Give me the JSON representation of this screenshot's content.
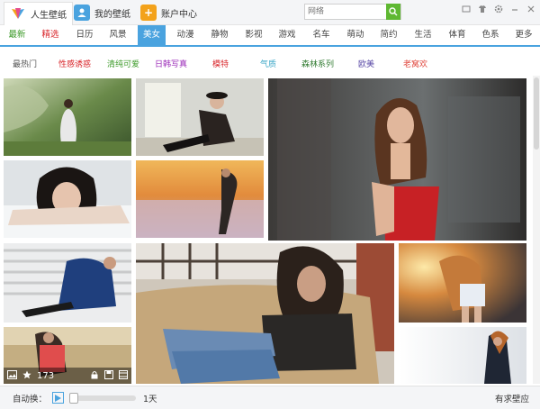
{
  "titlebar": {
    "tabs": [
      {
        "label": "人生壁纸",
        "icon": "app-logo-icon"
      },
      {
        "label": "我的壁纸",
        "icon": "user-icon"
      },
      {
        "label": "账户中心",
        "icon": "plus-icon"
      }
    ],
    "search_placeholder": "网络",
    "window_controls": [
      "skin-icon",
      "shirt-icon",
      "settings-icon",
      "minimize-icon",
      "close-icon"
    ]
  },
  "categories": [
    "最新",
    "精选",
    "日历",
    "风景",
    "美女",
    "动漫",
    "静物",
    "影视",
    "游戏",
    "名车",
    "萌动",
    "简约",
    "生活",
    "体育",
    "色系",
    "更多"
  ],
  "active_category": "美女",
  "subcategories": [
    {
      "label": "最热门",
      "color": "#555555"
    },
    {
      "label": "性感诱惑",
      "color": "#d9262b"
    },
    {
      "label": "清纯可爱",
      "color": "#3e9b2b"
    },
    {
      "label": "日韩写真",
      "color": "#9b2bb8"
    },
    {
      "label": "模特",
      "color": "#d9262b"
    },
    {
      "label": "气质",
      "color": "#3aa6c6"
    },
    {
      "label": "森林系列",
      "color": "#2f7a2f"
    },
    {
      "label": "欧美",
      "color": "#5a4aa6"
    },
    {
      "label": "老窝欢",
      "color": "#e0463c"
    }
  ],
  "grid_overlay": {
    "likes": "173"
  },
  "bottombar": {
    "auto_switch_label": "自动换：",
    "interval": "1天",
    "request_label": "有求壁应"
  }
}
